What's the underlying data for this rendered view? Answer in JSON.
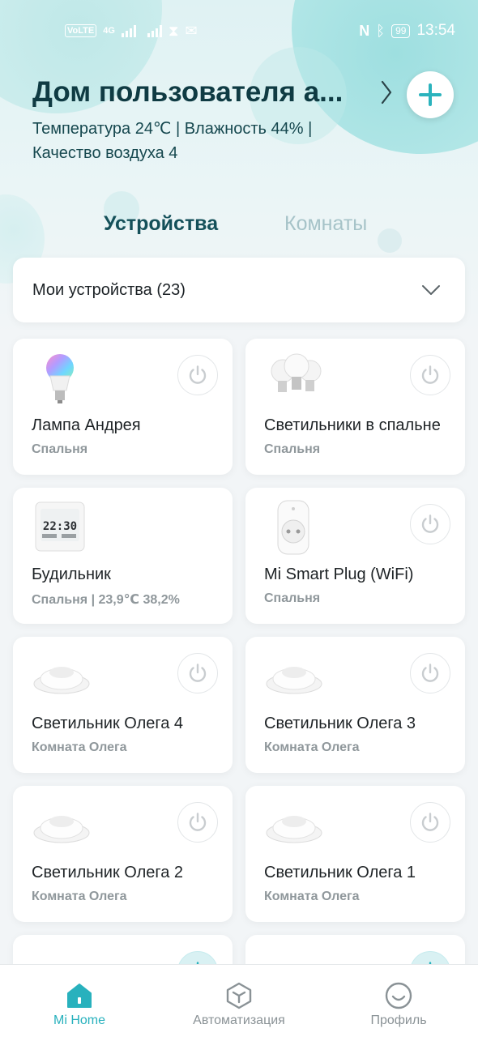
{
  "status_bar": {
    "volte": "VoLTE",
    "network": "4G",
    "battery": "99",
    "time": "13:54"
  },
  "header": {
    "home_name": "Дом пользователя а...",
    "env_line_1": "Температура 24℃ | Влажность 44% |",
    "env_line_2": "Качество воздуха 4"
  },
  "tabs": {
    "devices": "Устройства",
    "rooms": "Комнаты"
  },
  "filter": {
    "label": "Мои устройства (23)"
  },
  "devices": [
    {
      "name": "Лампа Андрея",
      "room": "Спальня",
      "icon": "color-bulb-icon"
    },
    {
      "name": "Светильники в спальне",
      "room": "Спальня",
      "icon": "bulbs-set-icon"
    },
    {
      "name": "Будильник",
      "room": "Спальня | 23,9℃ 38,2%",
      "icon": "clock-sensor-icon",
      "display_time": "22:30"
    },
    {
      "name": "Mi Smart Plug (WiFi)",
      "room": "Спальня",
      "icon": "smart-plug-icon"
    },
    {
      "name": "Светильник Олега 4",
      "room": "Комната Олега",
      "icon": "downlight-icon"
    },
    {
      "name": "Светильник Олега 3",
      "room": "Комната Олега",
      "icon": "downlight-icon"
    },
    {
      "name": "Светильник Олега 2",
      "room": "Комната Олега",
      "icon": "downlight-icon"
    },
    {
      "name": "Светильник Олега 1",
      "room": "Комната Олега",
      "icon": "downlight-icon"
    }
  ],
  "bottom_nav": {
    "home": "Mi Home",
    "automation": "Автоматизация",
    "profile": "Профиль"
  },
  "colors": {
    "accent": "#28b1bd",
    "title": "#0f3b43"
  }
}
